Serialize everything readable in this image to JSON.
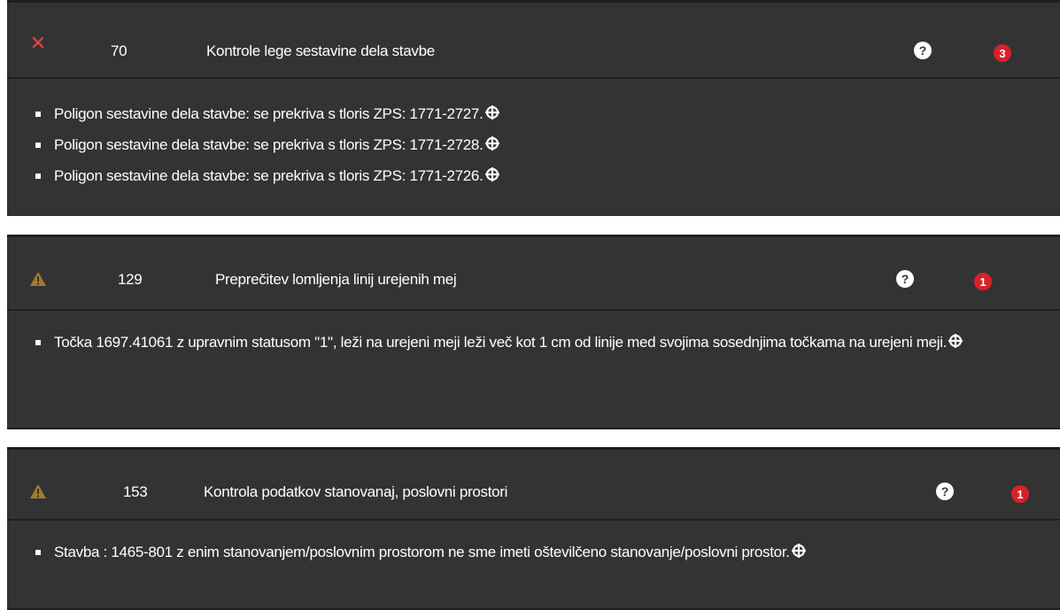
{
  "panels": [
    {
      "status_icon": "close-icon",
      "status_color": "#d9453e",
      "number": "70",
      "title": "Kontrole lege sestavine dela stavbe",
      "help_label": "?",
      "count": "3",
      "messages": [
        "Poligon sestavine dela stavbe: se prekriva s tloris ZPS: 1771-2727.",
        "Poligon sestavine dela stavbe: se prekriva s tloris ZPS: 1771-2728.",
        "Poligon sestavine dela stavbe: se prekriva s tloris ZPS: 1771-2726."
      ]
    },
    {
      "status_icon": "warning-icon",
      "status_color": "#a57a2e",
      "number": "129",
      "title": "Preprečitev lomljenja linij urejenih mej",
      "help_label": "?",
      "count": "1",
      "messages": [
        "Točka 1697.41061 z upravnim statusom \"1\", leži na urejeni meji leži več kot 1 cm od linije med svojima sosednjima točkama na urejeni meji."
      ]
    },
    {
      "status_icon": "warning-icon",
      "status_color": "#a57a2e",
      "number": "153",
      "title": "Kontrola podatkov stanovanaj, poslovni prostori",
      "help_label": "?",
      "count": "1",
      "messages": [
        "Stavba : 1465-801 z enim stanovanjem/poslovnim prostorom ne sme imeti oštevilčeno stanovanje/poslovni prostor."
      ]
    }
  ],
  "colors": {
    "panel_bg": "#333333",
    "badge_red": "#d9202a",
    "text": "#ffffff"
  }
}
